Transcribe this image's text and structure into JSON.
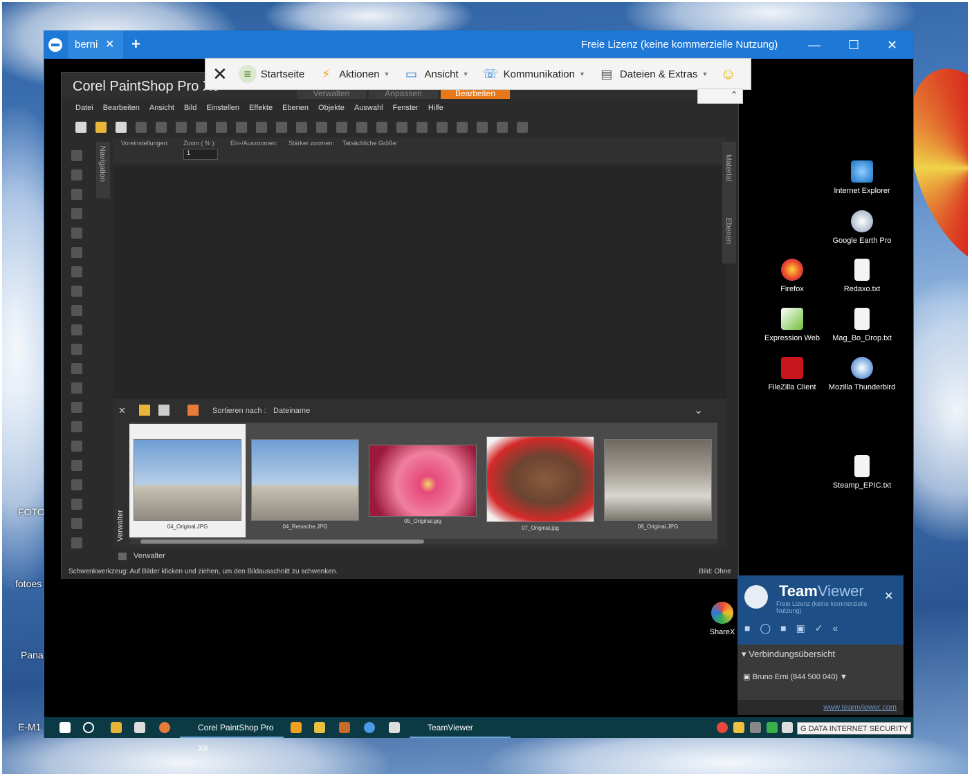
{
  "desktop_left_labels": [
    "FOTO",
    "fotoes",
    "Pana",
    "E-M1"
  ],
  "teamviewer_window": {
    "tab_label": "berni",
    "tab_close": "✕",
    "new_tab": "+",
    "license_text": "Freie Lizenz (keine kommerzielle Nutzung)",
    "minimize": "—",
    "maximize": "☐",
    "close": "✕"
  },
  "tv_toolbar": {
    "close": "✕",
    "items": [
      {
        "label": "Startseite",
        "icon": "home-icon"
      },
      {
        "label": "Aktionen",
        "icon": "lightning-icon",
        "dropdown": true
      },
      {
        "label": "Ansicht",
        "icon": "monitor-icon",
        "dropdown": true
      },
      {
        "label": "Kommunikation",
        "icon": "chat-icon",
        "dropdown": true
      },
      {
        "label": "Dateien & Extras",
        "icon": "files-icon",
        "dropdown": true
      }
    ],
    "smiley": "☺"
  },
  "psp": {
    "app_title": "Corel PaintShop Pro X8",
    "mode_tabs": [
      "Verwalten",
      "Anpassen",
      "Bearbeiten"
    ],
    "active_mode": "Bearbeiten",
    "menu": [
      "Datei",
      "Bearbeiten",
      "Ansicht",
      "Bild",
      "Einstellen",
      "Effekte",
      "Ebenen",
      "Objekte",
      "Auswahl",
      "Fenster",
      "Hilfe"
    ],
    "options": {
      "voreinstellungen": "Voreinstellungen:",
      "zoom": "Zoom ( % ):",
      "zoom_value": "1",
      "ein_aus": "Ein-/Auszoomen:",
      "staerker": "Stärker zoomen:",
      "tatsaechlich": "Tatsächliche Größe:"
    },
    "nav_panel": "Navigation",
    "right_panels": [
      "Material",
      "Ebenen"
    ],
    "organizer": {
      "sort_label": "Sortieren nach :",
      "sort_value": "Dateiname",
      "side_label": "Verwalter",
      "footer_label": "Verwalter",
      "thumbnails": [
        {
          "name": "04_Original.JPG",
          "selected": true
        },
        {
          "name": "04_Retusche.JPG",
          "selected": false
        },
        {
          "name": "05_Original.jpg",
          "selected": false
        },
        {
          "name": "07_Original.jpg",
          "selected": false
        },
        {
          "name": "08_Original.JPG",
          "selected": false
        }
      ]
    },
    "status_text": "Schwenkwerkzeug: Auf Bilder klicken und ziehen, um den Bildausschnitt zu schwenken.",
    "status_right": "Bild: Ohne"
  },
  "desktop_icons": [
    {
      "label": "Internet Explorer",
      "icon": "internet-explorer-icon"
    },
    {
      "label": "Google Earth Pro",
      "icon": "google-earth-icon"
    },
    {
      "label": "Firefox",
      "icon": "firefox-icon"
    },
    {
      "label": "Redaxo.txt",
      "icon": "text-file-icon"
    },
    {
      "label": "Expression Web",
      "icon": "expression-web-icon"
    },
    {
      "label": "Mag_Bo_Drop.txt",
      "icon": "text-file-icon"
    },
    {
      "label": "FileZilla Client",
      "icon": "filezilla-icon"
    },
    {
      "label": "Mozilla Thunderbird",
      "icon": "thunderbird-icon"
    },
    {
      "label": "Steamp_EPIC.txt",
      "icon": "text-file-icon"
    },
    {
      "label": "ShareX",
      "icon": "sharex-icon"
    }
  ],
  "tv_panel": {
    "brand_bold": "Team",
    "brand_light": "Viewer",
    "license": "Freie Lizenz (keine kommerzielle Nutzung)",
    "close": "✕",
    "section": "Verbindungsübersicht",
    "connection": "Bruno Erni (844 500 040)",
    "link": "www.teamviewer.com"
  },
  "taskbar": {
    "apps": [
      "Corel PaintShop Pro X8",
      "TeamViewer"
    ],
    "tray_text": "G DATA INTERNET SECURITY"
  }
}
